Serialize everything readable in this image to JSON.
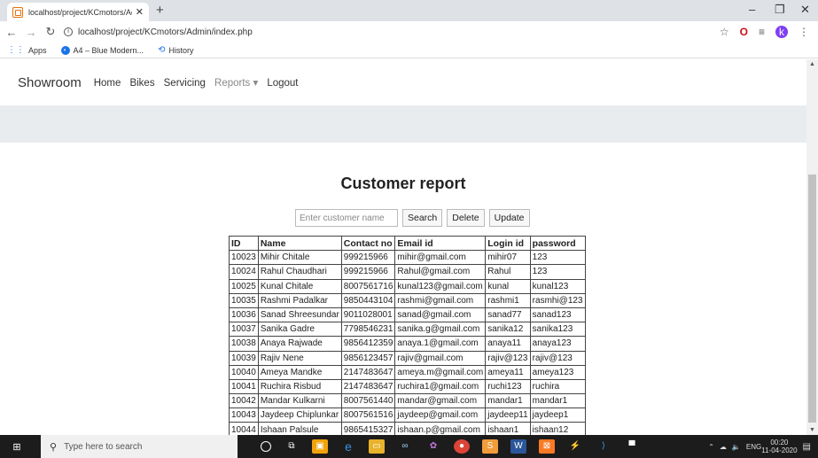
{
  "browser": {
    "tab_title": "localhost/project/KCmotors/Adm",
    "url": "localhost/project/KCmotors/Admin/index.php",
    "profile_initial": "k"
  },
  "bookmarks": [
    {
      "label": "Apps",
      "icon": "apps-grid-icon"
    },
    {
      "label": "A4 – Blue Modern...",
      "icon": "bookmark-favicon-icon"
    },
    {
      "label": "History",
      "icon": "history-icon"
    }
  ],
  "site": {
    "brand": "Showroom",
    "nav": [
      "Home",
      "Bikes",
      "Servicing",
      "Reports ▾",
      "Logout"
    ]
  },
  "report": {
    "title": "Customer report",
    "search_placeholder": "Enter customer name",
    "buttons": {
      "search": "Search",
      "delete": "Delete",
      "update": "Update"
    },
    "columns": [
      "ID",
      "Name",
      "Contact no",
      "Email id",
      "Login id",
      "password"
    ],
    "rows": [
      [
        "10023",
        "Mihir Chitale",
        "999215966",
        "mihir@gmail.com",
        "mihir07",
        "123"
      ],
      [
        "10024",
        "Rahul Chaudhari",
        "999215966",
        "Rahul@gmail.com",
        "Rahul",
        "123"
      ],
      [
        "10025",
        "Kunal Chitale",
        "8007561716",
        "kunal123@gmail.com",
        "kunal",
        "kunal123"
      ],
      [
        "10035",
        "Rashmi Padalkar",
        "9850443104",
        "rashmi@gmail.com",
        "rashmi1",
        "rasmhi@123"
      ],
      [
        "10036",
        "Sanad Shreesundar",
        "9011028001",
        "sanad@gmail.com",
        "sanad77",
        "sanad123"
      ],
      [
        "10037",
        "Sanika Gadre",
        "7798546231",
        "sanika.g@gmail.com",
        "sanika12",
        "sanika123"
      ],
      [
        "10038",
        "Anaya Rajwade",
        "9856412359",
        "anaya.1@gmail.com",
        "anaya11",
        "anaya123"
      ],
      [
        "10039",
        "Rajiv Nene",
        "9856123457",
        "rajiv@gmail.com",
        "rajiv@123",
        "rajiv@123"
      ],
      [
        "10040",
        "Ameya Mandke",
        "2147483647",
        "ameya.m@gmail.com",
        "ameya11",
        "ameya123"
      ],
      [
        "10041",
        "Ruchira Risbud",
        "2147483647",
        "ruchira1@gmail.com",
        "ruchi123",
        "ruchira"
      ],
      [
        "10042",
        "Mandar Kulkarni",
        "8007561440",
        "mandar@gmail.com",
        "mandar1",
        "mandar1"
      ],
      [
        "10043",
        "Jaydeep Chiplunkar",
        "8007561516",
        "jaydeep@gmail.com",
        "jaydeep11",
        "jaydeep1"
      ],
      [
        "10044",
        "Ishaan Palsule",
        "9865415327",
        "ishaan.p@gmail.com",
        "ishaan1",
        "ishaan12"
      ]
    ]
  },
  "taskbar": {
    "search_placeholder": "Type here to search",
    "language": "ENG",
    "time": "00:20",
    "date": "11-04-2020"
  }
}
